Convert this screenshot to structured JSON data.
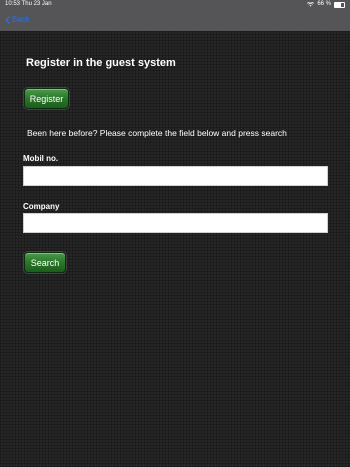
{
  "status_bar": {
    "time": "10:53",
    "date": "Thu 23 Jan",
    "battery": "66 %",
    "wifi_icon": "wifi-icon",
    "battery_level": 0.66
  },
  "nav": {
    "back_label": "Back",
    "accent": "#2f6fe0"
  },
  "page": {
    "title": "Register in the guest system"
  },
  "register_button": {
    "label": "Register"
  },
  "intro_text": "Been here before? Please complete the field below and press search",
  "mobile": {
    "label": "Mobil no.",
    "value": "",
    "placeholder": ""
  },
  "company": {
    "label": "Company",
    "value": "",
    "placeholder": ""
  },
  "search_button": {
    "label": "Search"
  },
  "colors": {
    "button_green": "#2c7a2c",
    "background": "#262626",
    "nav_bar": "#555557"
  }
}
